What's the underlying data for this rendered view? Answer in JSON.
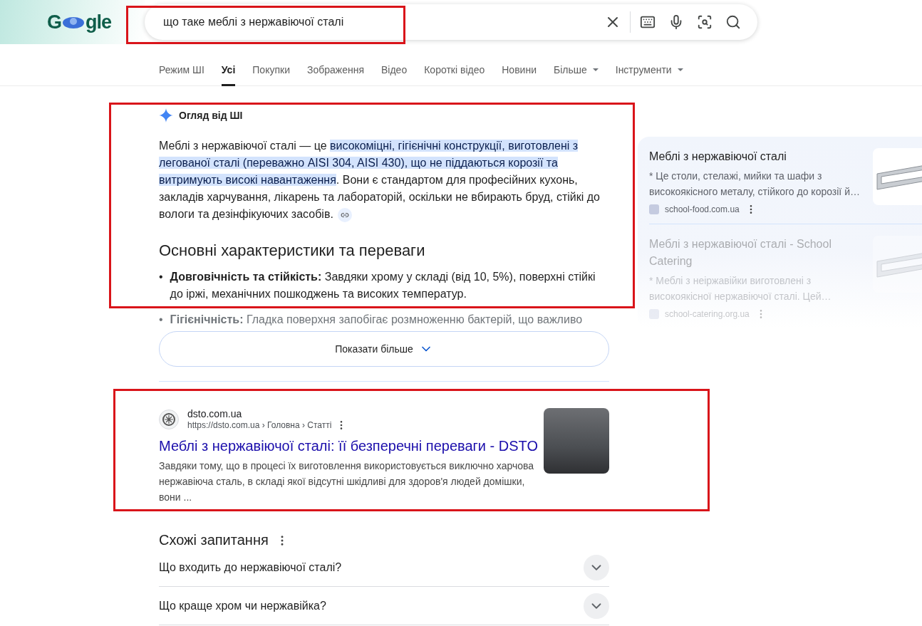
{
  "logo": {
    "left": "G",
    "right": "gle"
  },
  "search": {
    "value": "що таке меблі з нержавіючої сталі"
  },
  "tabs": [
    {
      "label": "Режим ШІ",
      "selected": false,
      "dropdown": false
    },
    {
      "label": "Усі",
      "selected": true,
      "dropdown": false
    },
    {
      "label": "Покупки",
      "selected": false,
      "dropdown": false
    },
    {
      "label": "Зображення",
      "selected": false,
      "dropdown": false
    },
    {
      "label": "Відео",
      "selected": false,
      "dropdown": false
    },
    {
      "label": "Короткі відео",
      "selected": false,
      "dropdown": false
    },
    {
      "label": "Новини",
      "selected": false,
      "dropdown": false
    },
    {
      "label": "Більше",
      "selected": false,
      "dropdown": true
    },
    {
      "label": "Інструменти",
      "selected": false,
      "dropdown": true
    }
  ],
  "overview": {
    "title": "Огляд від ШІ",
    "paragraph": [
      {
        "text": "Меблі з нержавіючої сталі — це ",
        "highlighted": false
      },
      {
        "text": "високоміцні, гігієнічні конструкції, виготовлені з легованої сталі (переважно AISI 304, AISI 430), що не піддаються корозії та витримують високі навантаження",
        "highlighted": true
      },
      {
        "text": ". Вони є стандартом для професійних кухонь, закладів харчування, лікарень та лабораторій, оскільки не вбирають бруд, стійкі до вологи та дезінфікуючих засобів.",
        "highlighted": false
      }
    ],
    "heading": "Основні характеристики та переваги",
    "bullets": [
      {
        "marker": "•",
        "faded": false,
        "term": "Довговічність та стійкість:",
        "text": "Завдяки хрому у складі (від 10, 5%), поверхні стійкі до іржі, механічних пошкоджень та високих температур."
      },
      {
        "marker": "•",
        "faded": true,
        "term": "Гігієнічність:",
        "text": "Гладка поверхня запобігає розмноженню бактерій, що важливо"
      }
    ],
    "show_more": "Показати більше"
  },
  "sources": [
    {
      "title": "Меблі з нержавіючої сталі",
      "snippet": "* Це столи, стелажі, мийки та шафи з високоякісного металу, стійкого до корозії й…",
      "site": "school-food.com.ua"
    },
    {
      "title": "Меблі з нержавіючої сталі - School Catering",
      "snippet": "* Меблі з неіржавійки виготовлені з високоякісної нержавіючої сталі. Цей…",
      "site": "school-catering.org.ua"
    }
  ],
  "result": {
    "site": "dsto.com.ua",
    "url": "https://dsto.com.ua › Головна › Статті",
    "title": "Меблі з нержавіючої сталі: її безперечні переваги - DSTO",
    "snippet": "Завдяки тому, що в процесі їх виготовлення використовується виключно харчова нержавіюча сталь, в складі якої відсутні шкідливі для здоров'я людей домішки, вони ..."
  },
  "related": {
    "title": "Схожі запитання",
    "questions": [
      {
        "text": "Що входить до нержавіючої сталі?",
        "expanded": false
      },
      {
        "text": "Що краще хром чи нержавійка?",
        "expanded": false
      }
    ]
  }
}
